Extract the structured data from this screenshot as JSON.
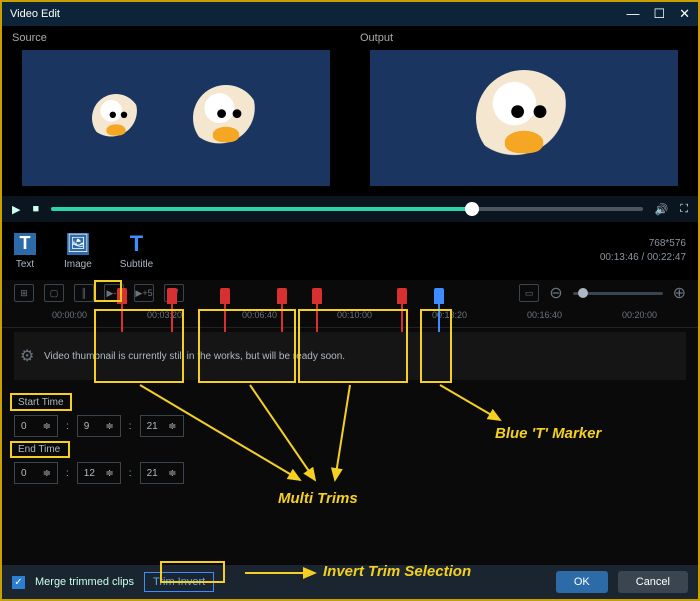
{
  "titlebar": {
    "title": "Video Edit"
  },
  "previews": {
    "source_label": "Source",
    "output_label": "Output"
  },
  "toolbar": {
    "text_label": "Text",
    "image_label": "Image",
    "subtitle_label": "Subtitle",
    "resolution": "768*576",
    "time_info": "00:13:46 / 00:22:47"
  },
  "editbar": {
    "skip_back": "▶-5",
    "skip_fwd": "▶+5"
  },
  "timeline": {
    "ticks": [
      "00:00:00",
      "00:03:20",
      "00:06:40",
      "00:10:00",
      "00:13:20",
      "00:16:40",
      "00:20:00"
    ],
    "msg": "Video thumbnail is currently still in the works, but will be ready soon."
  },
  "time_inputs": {
    "start_label": "Start Time",
    "end_label": "End Time",
    "start": {
      "h": "0",
      "m": "9",
      "s": "21"
    },
    "end": {
      "h": "0",
      "m": "12",
      "s": "21"
    }
  },
  "footer": {
    "merge_label": "Merge trimmed clips",
    "trim_invert": "Trim Invert",
    "ok": "OK",
    "cancel": "Cancel"
  },
  "annotations": {
    "multi_trims": "Multi Trims",
    "blue_marker": "Blue 'T' Marker",
    "invert_trim": "Invert Trim Selection"
  }
}
